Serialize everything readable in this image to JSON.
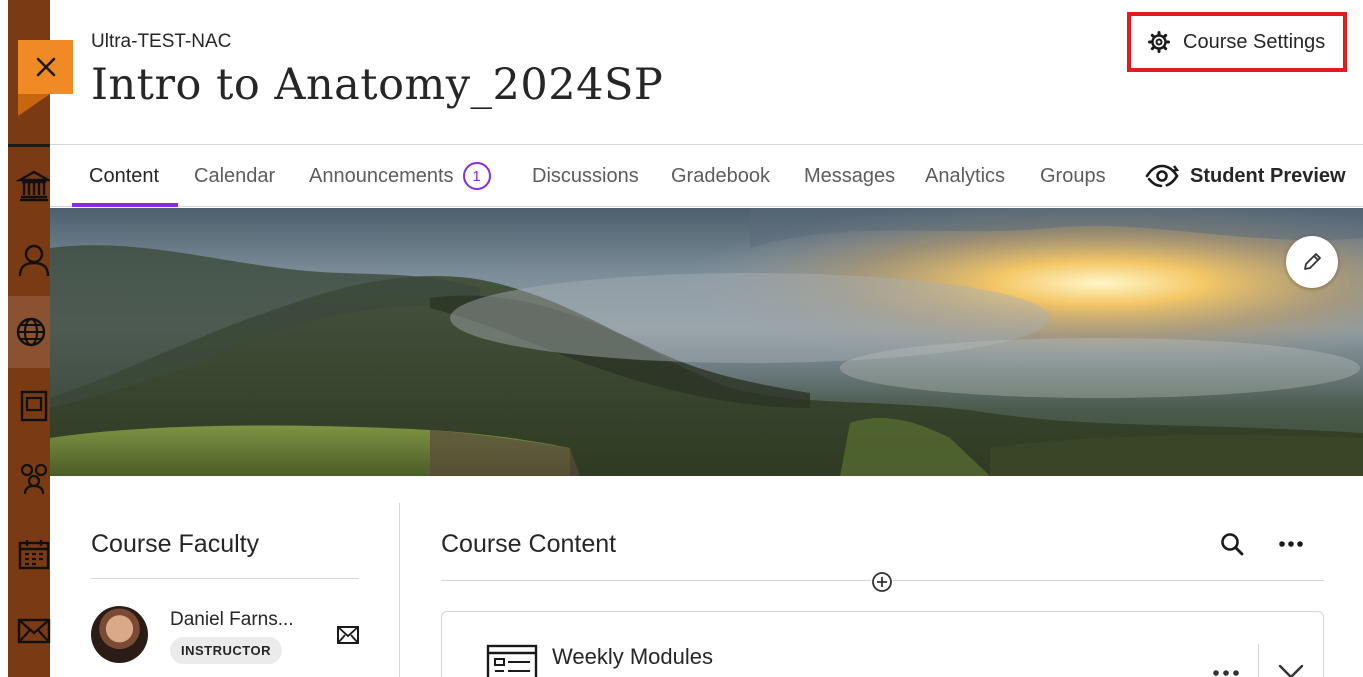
{
  "header": {
    "org_name": "Ultra-TEST-NAC",
    "course_title": "Intro to Anatomy_2024SP",
    "settings_label": "Course Settings"
  },
  "nav": {
    "tabs": [
      {
        "label": "Content",
        "active": true
      },
      {
        "label": "Calendar"
      },
      {
        "label": "Announcements",
        "badge": "1"
      },
      {
        "label": "Discussions"
      },
      {
        "label": "Gradebook"
      },
      {
        "label": "Messages"
      },
      {
        "label": "Analytics"
      },
      {
        "label": "Groups"
      }
    ],
    "preview_label": "Student Preview"
  },
  "rail": {
    "icons": [
      "institution-icon",
      "profile-icon",
      "globe-icon",
      "courses-icon",
      "groups-icon",
      "calendar-icon",
      "messages-icon"
    ]
  },
  "faculty": {
    "title": "Course Faculty",
    "name": "Daniel Farns...",
    "role": "INSTRUCTOR"
  },
  "content": {
    "title": "Course Content",
    "module_title": "Weekly Modules"
  },
  "colors": {
    "accent": "#8a2be2",
    "highlight_border": "#e8191a",
    "close_tab": "#f08a24",
    "rail": "#7a3b14"
  }
}
